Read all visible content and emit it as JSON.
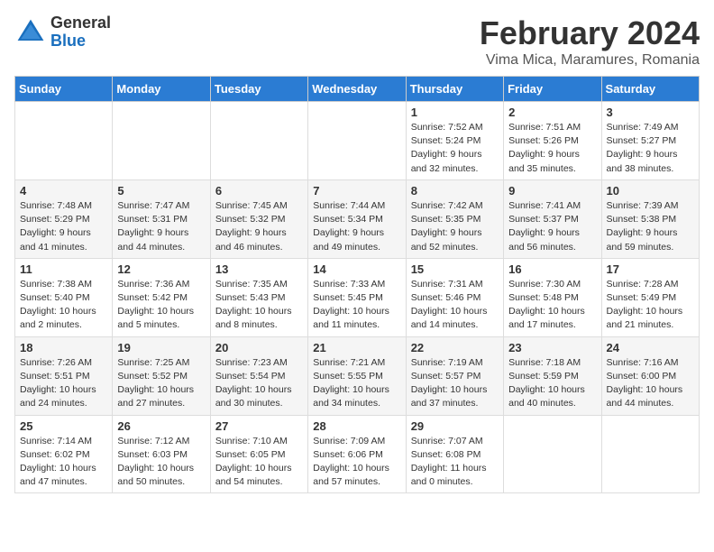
{
  "logo": {
    "general": "General",
    "blue": "Blue"
  },
  "title": {
    "month_year": "February 2024",
    "location": "Vima Mica, Maramures, Romania"
  },
  "headers": [
    "Sunday",
    "Monday",
    "Tuesday",
    "Wednesday",
    "Thursday",
    "Friday",
    "Saturday"
  ],
  "weeks": [
    [
      {
        "day": "",
        "info": ""
      },
      {
        "day": "",
        "info": ""
      },
      {
        "day": "",
        "info": ""
      },
      {
        "day": "",
        "info": ""
      },
      {
        "day": "1",
        "info": "Sunrise: 7:52 AM\nSunset: 5:24 PM\nDaylight: 9 hours\nand 32 minutes."
      },
      {
        "day": "2",
        "info": "Sunrise: 7:51 AM\nSunset: 5:26 PM\nDaylight: 9 hours\nand 35 minutes."
      },
      {
        "day": "3",
        "info": "Sunrise: 7:49 AM\nSunset: 5:27 PM\nDaylight: 9 hours\nand 38 minutes."
      }
    ],
    [
      {
        "day": "4",
        "info": "Sunrise: 7:48 AM\nSunset: 5:29 PM\nDaylight: 9 hours\nand 41 minutes."
      },
      {
        "day": "5",
        "info": "Sunrise: 7:47 AM\nSunset: 5:31 PM\nDaylight: 9 hours\nand 44 minutes."
      },
      {
        "day": "6",
        "info": "Sunrise: 7:45 AM\nSunset: 5:32 PM\nDaylight: 9 hours\nand 46 minutes."
      },
      {
        "day": "7",
        "info": "Sunrise: 7:44 AM\nSunset: 5:34 PM\nDaylight: 9 hours\nand 49 minutes."
      },
      {
        "day": "8",
        "info": "Sunrise: 7:42 AM\nSunset: 5:35 PM\nDaylight: 9 hours\nand 52 minutes."
      },
      {
        "day": "9",
        "info": "Sunrise: 7:41 AM\nSunset: 5:37 PM\nDaylight: 9 hours\nand 56 minutes."
      },
      {
        "day": "10",
        "info": "Sunrise: 7:39 AM\nSunset: 5:38 PM\nDaylight: 9 hours\nand 59 minutes."
      }
    ],
    [
      {
        "day": "11",
        "info": "Sunrise: 7:38 AM\nSunset: 5:40 PM\nDaylight: 10 hours\nand 2 minutes."
      },
      {
        "day": "12",
        "info": "Sunrise: 7:36 AM\nSunset: 5:42 PM\nDaylight: 10 hours\nand 5 minutes."
      },
      {
        "day": "13",
        "info": "Sunrise: 7:35 AM\nSunset: 5:43 PM\nDaylight: 10 hours\nand 8 minutes."
      },
      {
        "day": "14",
        "info": "Sunrise: 7:33 AM\nSunset: 5:45 PM\nDaylight: 10 hours\nand 11 minutes."
      },
      {
        "day": "15",
        "info": "Sunrise: 7:31 AM\nSunset: 5:46 PM\nDaylight: 10 hours\nand 14 minutes."
      },
      {
        "day": "16",
        "info": "Sunrise: 7:30 AM\nSunset: 5:48 PM\nDaylight: 10 hours\nand 17 minutes."
      },
      {
        "day": "17",
        "info": "Sunrise: 7:28 AM\nSunset: 5:49 PM\nDaylight: 10 hours\nand 21 minutes."
      }
    ],
    [
      {
        "day": "18",
        "info": "Sunrise: 7:26 AM\nSunset: 5:51 PM\nDaylight: 10 hours\nand 24 minutes."
      },
      {
        "day": "19",
        "info": "Sunrise: 7:25 AM\nSunset: 5:52 PM\nDaylight: 10 hours\nand 27 minutes."
      },
      {
        "day": "20",
        "info": "Sunrise: 7:23 AM\nSunset: 5:54 PM\nDaylight: 10 hours\nand 30 minutes."
      },
      {
        "day": "21",
        "info": "Sunrise: 7:21 AM\nSunset: 5:55 PM\nDaylight: 10 hours\nand 34 minutes."
      },
      {
        "day": "22",
        "info": "Sunrise: 7:19 AM\nSunset: 5:57 PM\nDaylight: 10 hours\nand 37 minutes."
      },
      {
        "day": "23",
        "info": "Sunrise: 7:18 AM\nSunset: 5:59 PM\nDaylight: 10 hours\nand 40 minutes."
      },
      {
        "day": "24",
        "info": "Sunrise: 7:16 AM\nSunset: 6:00 PM\nDaylight: 10 hours\nand 44 minutes."
      }
    ],
    [
      {
        "day": "25",
        "info": "Sunrise: 7:14 AM\nSunset: 6:02 PM\nDaylight: 10 hours\nand 47 minutes."
      },
      {
        "day": "26",
        "info": "Sunrise: 7:12 AM\nSunset: 6:03 PM\nDaylight: 10 hours\nand 50 minutes."
      },
      {
        "day": "27",
        "info": "Sunrise: 7:10 AM\nSunset: 6:05 PM\nDaylight: 10 hours\nand 54 minutes."
      },
      {
        "day": "28",
        "info": "Sunrise: 7:09 AM\nSunset: 6:06 PM\nDaylight: 10 hours\nand 57 minutes."
      },
      {
        "day": "29",
        "info": "Sunrise: 7:07 AM\nSunset: 6:08 PM\nDaylight: 11 hours\nand 0 minutes."
      },
      {
        "day": "",
        "info": ""
      },
      {
        "day": "",
        "info": ""
      }
    ]
  ]
}
